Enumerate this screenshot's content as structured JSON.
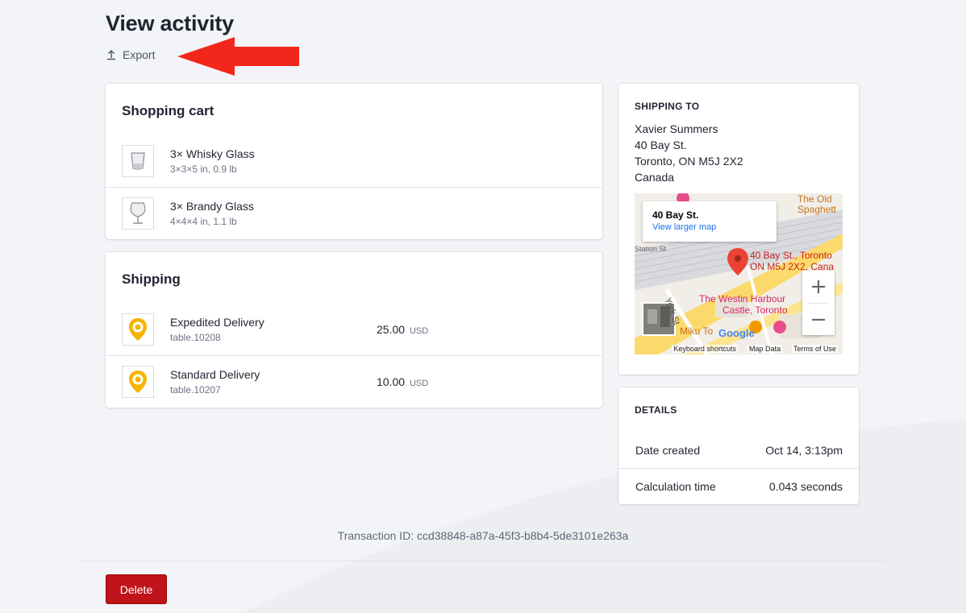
{
  "page": {
    "title": "View activity",
    "export_label": "Export"
  },
  "cart": {
    "title": "Shopping cart",
    "items": [
      {
        "name": "3× Whisky Glass",
        "dims": "3×3×5 in, 0.9 lb"
      },
      {
        "name": "3× Brandy Glass",
        "dims": "4×4×4 in, 1.1 lb"
      }
    ]
  },
  "shipping": {
    "title": "Shipping",
    "options": [
      {
        "name": "Expedited Delivery",
        "code": "table.10208",
        "price": "25.00",
        "currency": "USD"
      },
      {
        "name": "Standard Delivery",
        "code": "table.10207",
        "price": "10.00",
        "currency": "USD"
      }
    ]
  },
  "shipping_to": {
    "label": "SHIPPING TO",
    "address": [
      "Xavier Summers",
      "40 Bay St.",
      "Toronto, ON M5J 2X2",
      "Canada"
    ],
    "map": {
      "card_title": "40 Bay St.",
      "card_link": "View larger map",
      "pin_label_1": "40 Bay St., Toronto",
      "pin_label_2": "ON M5J 2X2, Cana",
      "poi_1a": "The Old",
      "poi_1b": "Spaghett",
      "poi_2a": "The Westin Harbour",
      "poi_2b": "Castle, Toronto",
      "poi_3": "Miku To",
      "street_1": "York St",
      "street_2": "Station St",
      "logo": "Google",
      "zoom_in": "+",
      "zoom_out": "−",
      "footer": [
        "Keyboard shortcuts",
        "Map Data",
        "Terms of Use"
      ]
    }
  },
  "details": {
    "label": "DETAILS",
    "rows": [
      {
        "key": "Date created",
        "value": "Oct 14, 3:13pm"
      },
      {
        "key": "Calculation time",
        "value": "0.043 seconds"
      }
    ]
  },
  "transaction": "Transaction ID: ccd38848-a87a-45f3-b8b4-5de3101e263a",
  "delete_label": "Delete",
  "colors": {
    "accent_red": "#c0131a",
    "pin_yellow": "#f5b400",
    "annotation_arrow": "#f3261c"
  }
}
